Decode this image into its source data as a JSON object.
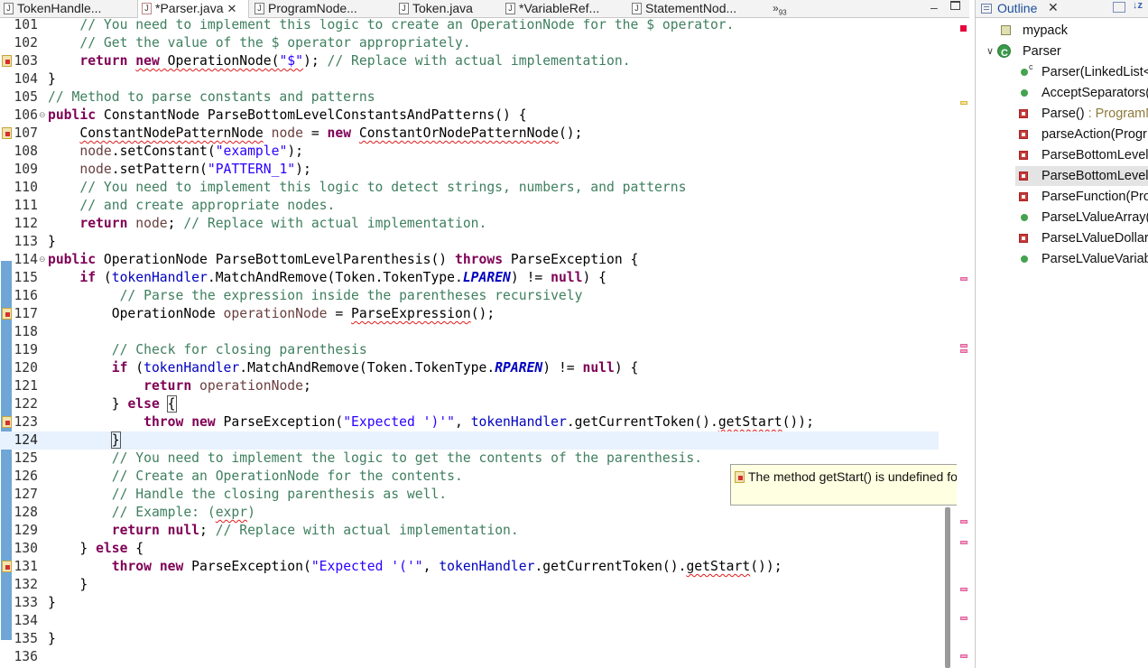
{
  "tabs": [
    {
      "label": "TokenHandle...",
      "icon": "java-file-icon",
      "active": false
    },
    {
      "label": "*Parser.java",
      "icon": "java-file-error-icon",
      "active": true
    },
    {
      "label": "ProgramNode...",
      "icon": "java-file-icon",
      "active": false
    },
    {
      "label": "Token.java",
      "icon": "java-file-icon",
      "active": false
    },
    {
      "label": "*VariableRef...",
      "icon": "java-file-icon",
      "active": false
    },
    {
      "label": "StatementNod...",
      "icon": "java-file-icon",
      "active": false
    }
  ],
  "overflow": {
    "chevron": "»",
    "count": "93"
  },
  "editor": {
    "lines": [
      {
        "n": "101",
        "text": "    // You need to implement this logic to create an OperationNode for the $ operator."
      },
      {
        "n": "102",
        "text": "    // Get the value of the $ operator appropriately."
      },
      {
        "n": "103",
        "text": "    return new OperationNode(\"$\"); // Replace with actual implementation."
      },
      {
        "n": "104",
        "text": "}"
      },
      {
        "n": "105",
        "text": "// Method to parse constants and patterns"
      },
      {
        "n": "106",
        "text": "public ConstantNode ParseBottomLevelConstantsAndPatterns() {"
      },
      {
        "n": "107",
        "text": "    ConstantNodePatternNode node = new ConstantOrNodePatternNode();"
      },
      {
        "n": "108",
        "text": "    node.setConstant(\"example\");"
      },
      {
        "n": "109",
        "text": "    node.setPattern(\"PATTERN_1\");"
      },
      {
        "n": "110",
        "text": "    // You need to implement this logic to detect strings, numbers, and patterns"
      },
      {
        "n": "111",
        "text": "    // and create appropriate nodes."
      },
      {
        "n": "112",
        "text": "    return node; // Replace with actual implementation."
      },
      {
        "n": "113",
        "text": "}"
      },
      {
        "n": "114",
        "text": "public OperationNode ParseBottomLevelParenthesis() throws ParseException {"
      },
      {
        "n": "115",
        "text": "    if (tokenHandler.MatchAndRemove(Token.TokenType.LPAREN) != null) {"
      },
      {
        "n": "116",
        "text": "         // Parse the expression inside the parentheses recursively"
      },
      {
        "n": "117",
        "text": "        OperationNode operationNode = ParseExpression();"
      },
      {
        "n": "118",
        "text": ""
      },
      {
        "n": "119",
        "text": "        // Check for closing parenthesis"
      },
      {
        "n": "120",
        "text": "        if (tokenHandler.MatchAndRemove(Token.TokenType.RPAREN) != null) {"
      },
      {
        "n": "121",
        "text": "            return operationNode;"
      },
      {
        "n": "122",
        "text": "        } else {"
      },
      {
        "n": "123",
        "text": "            throw new ParseException(\"Expected ')'\", tokenHandler.getCurrentToken().getStart());"
      },
      {
        "n": "124",
        "text": "        }"
      },
      {
        "n": "125",
        "text": "        // You need to implement the logic to get the contents of the parenthesis."
      },
      {
        "n": "126",
        "text": "        // Create an OperationNode for the contents."
      },
      {
        "n": "127",
        "text": "        // Handle the closing parenthesis as well."
      },
      {
        "n": "128",
        "text": "        // Example: (expr)"
      },
      {
        "n": "129",
        "text": "        return null; // Replace with actual implementation."
      },
      {
        "n": "130",
        "text": "    } else {"
      },
      {
        "n": "131",
        "text": "        throw new ParseException(\"Expected '('\", tokenHandler.getCurrentToken().getStart());"
      },
      {
        "n": "132",
        "text": "    }"
      },
      {
        "n": "133",
        "text": "}"
      },
      {
        "n": "134",
        "text": ""
      },
      {
        "n": "135",
        "text": "}"
      },
      {
        "n": "136",
        "text": ""
      }
    ]
  },
  "hover": {
    "message": "The method getStart() is undefined for the type Optional<Token>"
  },
  "outline": {
    "title": "Outline",
    "sort_label": "↓z",
    "items": [
      {
        "label": "mypack",
        "kind": "package-icon"
      },
      {
        "label": "Parser",
        "kind": "class-icon",
        "twisty": "∨"
      },
      {
        "label": "Parser(LinkedList<",
        "kind": "public-constructor-icon",
        "ctor": "c"
      },
      {
        "label": "AcceptSeparators(",
        "kind": "public-method-icon"
      },
      {
        "label": "Parse()",
        "return": " : ProgramN",
        "kind": "private-method-error-icon"
      },
      {
        "label": "parseAction(Progr",
        "kind": "private-method-icon"
      },
      {
        "label": "ParseBottomLevel",
        "kind": "private-method-error-icon"
      },
      {
        "label": "ParseBottomLevel",
        "kind": "private-method-error-icon",
        "selected": true
      },
      {
        "label": "ParseFunction(Prog",
        "kind": "private-method-icon"
      },
      {
        "label": "ParseLValueArray(S",
        "kind": "public-method-icon"
      },
      {
        "label": "ParseLValueDollar(",
        "kind": "private-method-error-icon"
      },
      {
        "label": "ParseLValueVariab",
        "kind": "public-method-icon"
      }
    ]
  },
  "colors": {
    "keyword": "#7f0055",
    "comment": "#3f7f5f",
    "string": "#2a00ff",
    "field": "#0000c0",
    "current_line": "#e8f2fe",
    "tooltip_bg": "#ffffe1"
  }
}
